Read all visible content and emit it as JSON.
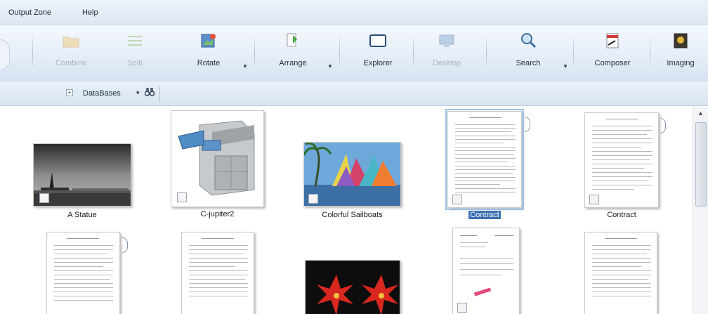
{
  "menu": [
    "Output Zone",
    "Help"
  ],
  "toolbar": {
    "combine": "Combine",
    "split": "Split",
    "rotate": "Rotate",
    "arrange": "Arrange",
    "explorer": "Explorer",
    "desktop": "Desktop",
    "search": "Search",
    "composer": "Composer",
    "imaging": "Imaging"
  },
  "databases": {
    "label": "DataBases",
    "toggle": "+",
    "arrow": "▾",
    "icon": "binoculars-icon"
  },
  "items": [
    {
      "caption": "A Statue",
      "type": "photo"
    },
    {
      "caption": "C-jupiter2",
      "type": "photo"
    },
    {
      "caption": "Colorful Sailboats",
      "type": "photo"
    },
    {
      "caption": "Contract",
      "type": "document",
      "selected": true
    },
    {
      "caption": "Contract",
      "type": "document"
    }
  ],
  "colors": {
    "selection": "#3a6fb0",
    "ribbon": "#e6eef8",
    "accent": "#9cc0e8"
  }
}
